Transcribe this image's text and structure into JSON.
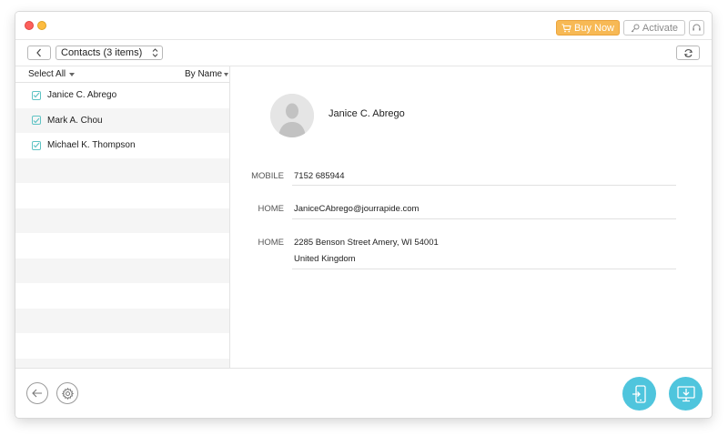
{
  "titlebar": {
    "buy_label": "Buy Now",
    "activate_label": "Activate"
  },
  "toolbar": {
    "category": "Contacts (3 items)"
  },
  "list": {
    "select_all": "Select All",
    "sort_label": "By Name",
    "items": [
      {
        "name": "Janice C. Abrego",
        "checked": true
      },
      {
        "name": "Mark A. Chou",
        "checked": true
      },
      {
        "name": "Michael K. Thompson",
        "checked": true
      }
    ]
  },
  "detail": {
    "name": "Janice C.  Abrego",
    "fields": [
      {
        "label": "MOBILE",
        "value": "7152 685944"
      },
      {
        "label": "HOME",
        "value": "JaniceCAbrego@jourrapide.com"
      },
      {
        "label": "HOME",
        "value": "2285 Benson Street Amery, WI 54001",
        "value2": "United Kingdom"
      }
    ]
  },
  "colors": {
    "accent": "#4fc5dd",
    "buy": "#f7b955",
    "check": "#5fc3c4"
  }
}
